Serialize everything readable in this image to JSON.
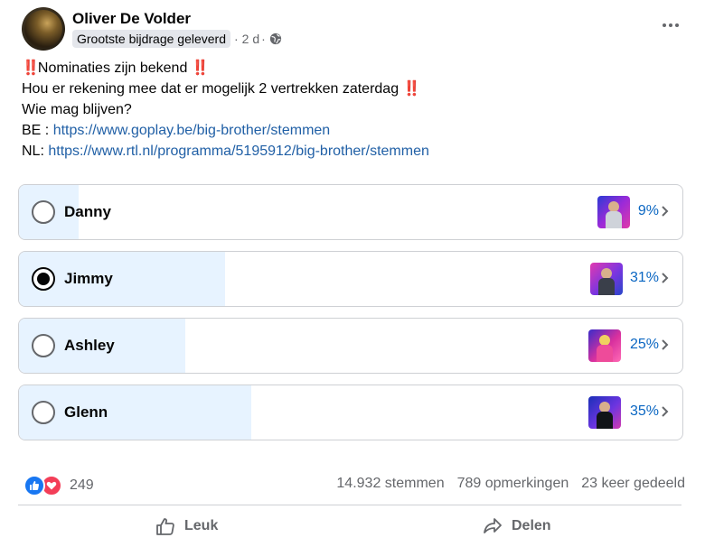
{
  "post": {
    "author": "Oliver De Volder",
    "badge": "Grootste bijdrage geleverd",
    "time": "2 d",
    "audience_icon": "globe-icon"
  },
  "text": {
    "line1": "Nominaties zijn bekend",
    "line2": "Hou er rekening mee dat er mogelijk 2 vertrekken zaterdag",
    "line3": "Wie mag blijven?",
    "be_prefix": "BE : ",
    "be_link": "https://www.goplay.be/big-brother/stemmen",
    "nl_prefix": "NL: ",
    "nl_link": "https://www.rtl.nl/programma/5195912/big-brother/stemmen",
    "emphasis": "‼️"
  },
  "poll": {
    "options": [
      {
        "label": "Danny",
        "percent": 9,
        "percent_text": "9%",
        "selected": false
      },
      {
        "label": "Jimmy",
        "percent": 31,
        "percent_text": "31%",
        "selected": true
      },
      {
        "label": "Ashley",
        "percent": 25,
        "percent_text": "25%",
        "selected": false
      },
      {
        "label": "Glenn",
        "percent": 35,
        "percent_text": "35%",
        "selected": false
      }
    ]
  },
  "stats": {
    "reactions_count": "249",
    "votes": "14.932 stemmen",
    "comments": "789 opmerkingen",
    "shares": "23 keer gedeeld"
  },
  "actions": {
    "like": "Leuk",
    "share": "Delen"
  },
  "colors": {
    "accent": "#0a66c2",
    "poll_fill": "#e7f3ff",
    "like": "#1877f2",
    "love": "#f33e58"
  }
}
